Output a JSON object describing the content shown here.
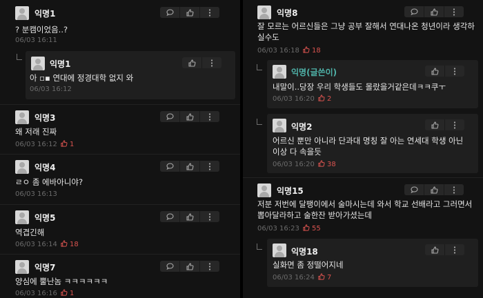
{
  "left": {
    "c1": {
      "name": "익명1",
      "text": "? 분캠이었음..?",
      "time": "06/03 16:11"
    },
    "c1r1": {
      "name": "익명1",
      "text": "아 ▫▪ 연대에 정경대학 없지 와",
      "time": "06/03 16:12"
    },
    "c3": {
      "name": "익명3",
      "text": "왜 저래 진짜",
      "time": "06/03 16:12",
      "likes": "1"
    },
    "c4": {
      "name": "익명4",
      "text": "ㄹㅇ 좀 에바아니야?",
      "time": "06/03 16:13"
    },
    "c5": {
      "name": "익명5",
      "text": "역겹긴해",
      "time": "06/03 16:14",
      "likes": "18"
    },
    "c7": {
      "name": "익명7",
      "text": "양심에 뿔난놈 ㅋㅋㅋㅋㅋㅋ",
      "time": "06/03 16:16",
      "likes": "1"
    }
  },
  "right": {
    "c8": {
      "name": "익명8",
      "text": "잘 모르는 어르신들은 그냥 공부 잘해서 연대나온 청년이라 생각하실수도",
      "time": "06/03 16:18",
      "likes": "18"
    },
    "c8r1": {
      "name": "익명(글쓴이)",
      "text": "내말이..당장 우리 학생들도 몰랐을거같은데ㅋㅋ쿠ㅜ",
      "time": "06/03 16:20",
      "likes": "2"
    },
    "c8r2": {
      "name": "익명2",
      "text": "어르신 뿐만 아니라 단과대 명칭 잘 아는 연세대 학생 아닌 이상 다 속을듯",
      "time": "06/03 16:20",
      "likes": "38"
    },
    "c15": {
      "name": "익명15",
      "text": "저분 저번에 달팽이에서 술마시는데 와서 학교 선배라고 그러면서 뽑아달라하고 술한잔 받아가셨는데",
      "time": "06/03 16:23",
      "likes": "55"
    },
    "c15r1": {
      "name": "익명18",
      "text": "실화면 좀 정떨어지네",
      "time": "06/03 16:24",
      "likes": "7"
    }
  },
  "colors": {
    "like": "#d9534f",
    "op_name": "#4fb3a9",
    "background": "#131313",
    "reply_bg": "#1f1f1f"
  },
  "icons": [
    "comment-icon",
    "thumbs-up-icon",
    "more-icon",
    "reply-arrow-icon",
    "avatar-icon"
  ]
}
